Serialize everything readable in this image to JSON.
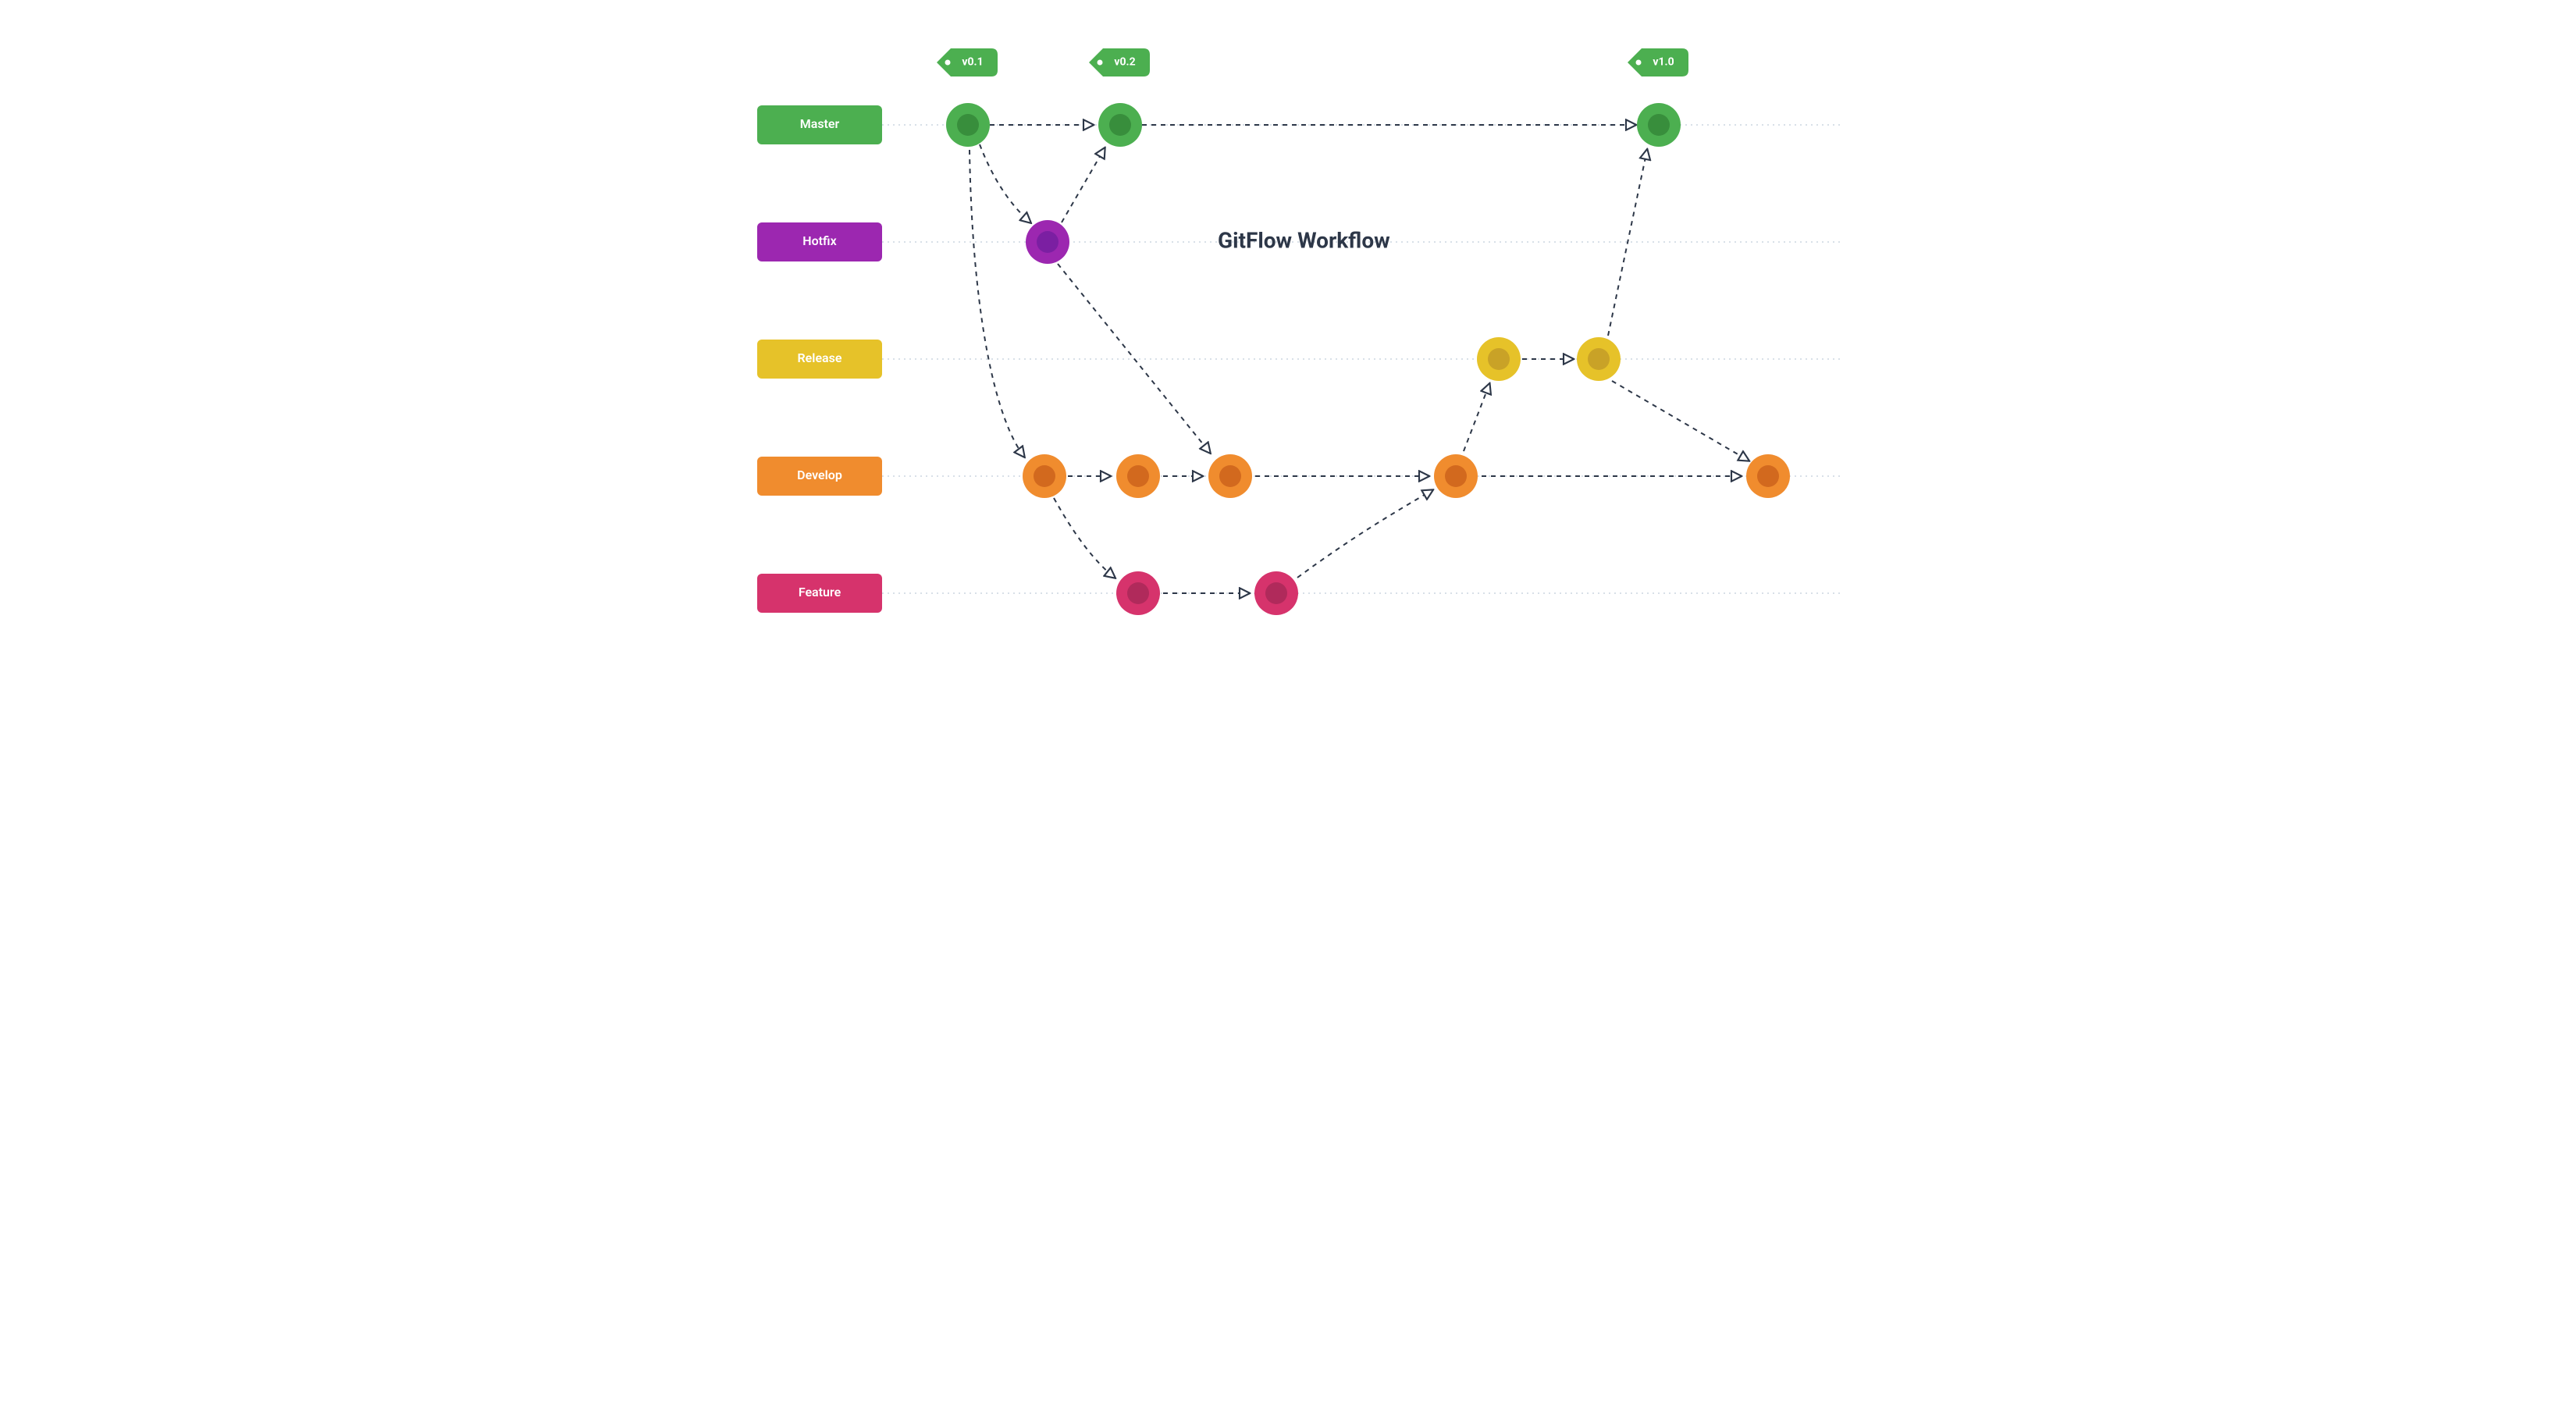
{
  "title": "GitFlow Workflow",
  "branches": {
    "master": {
      "label": "Master",
      "color": "#4caf50",
      "dark": "#388e3c"
    },
    "hotfix": {
      "label": "Hotfix",
      "color": "#9c27b0",
      "dark": "#7b1fa2"
    },
    "release": {
      "label": "Release",
      "color": "#e6c229",
      "dark": "#c9a227"
    },
    "develop": {
      "label": "Develop",
      "color": "#f08c2e",
      "dark": "#d2691e"
    },
    "feature": {
      "label": "Feature",
      "color": "#d6336c",
      "dark": "#b02a5b"
    }
  },
  "tags": {
    "t1": "v0.1",
    "t2": "v0.2",
    "t3": "v1.0"
  },
  "colors": {
    "text": "#2d3748",
    "lane": "#cbd5e0"
  }
}
